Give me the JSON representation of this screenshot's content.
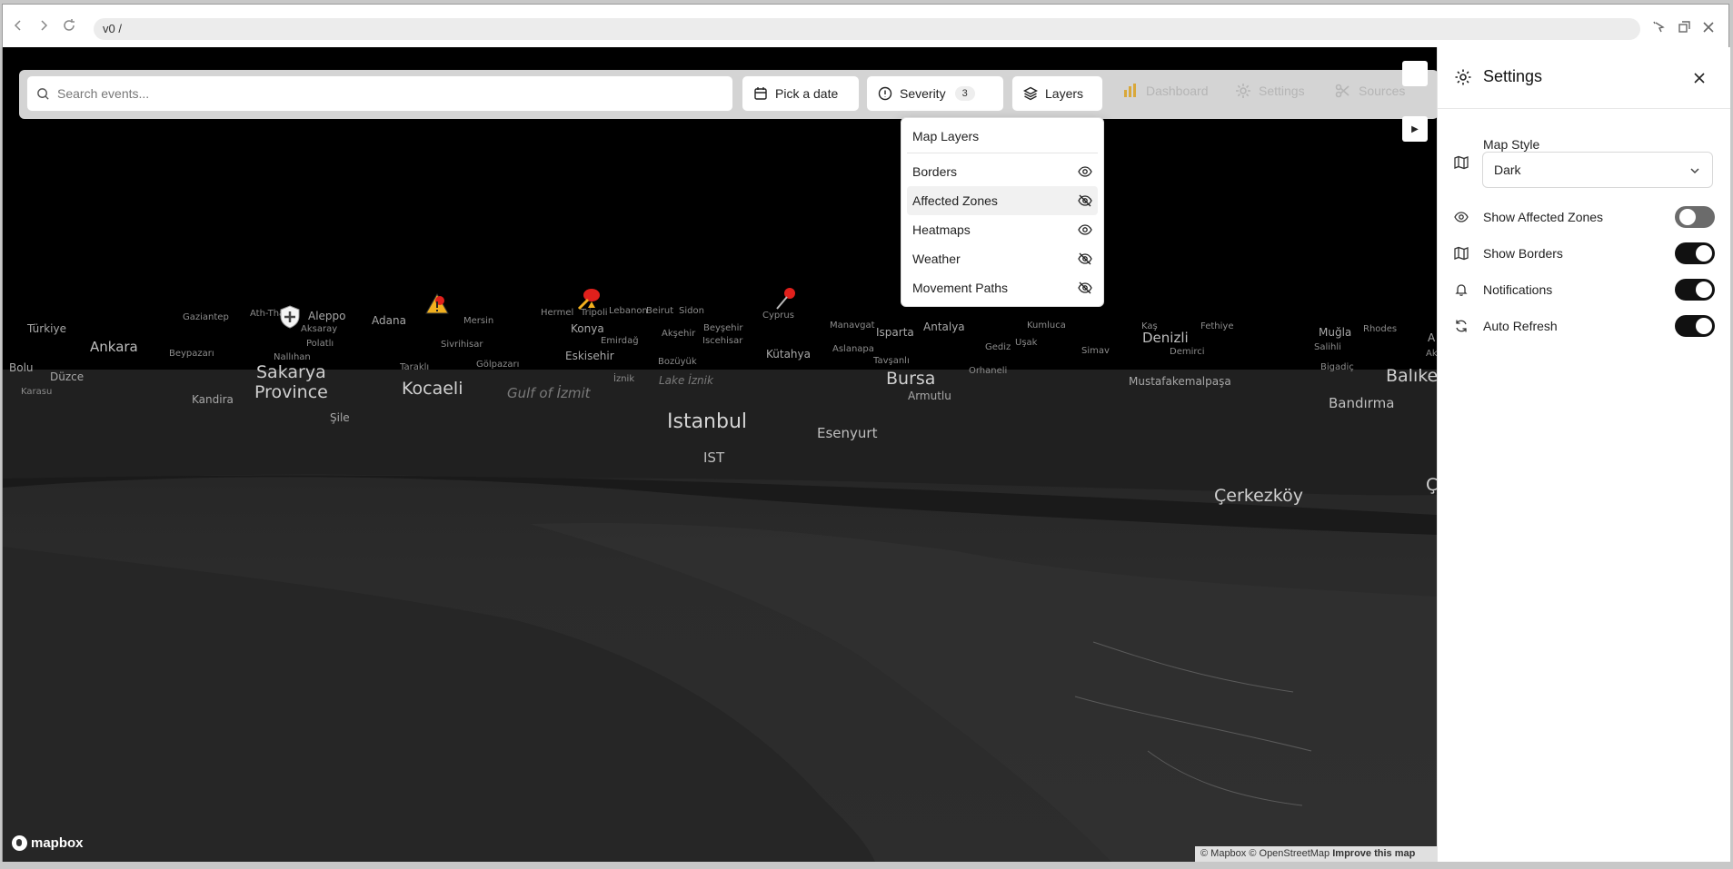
{
  "browser": {
    "url": "v0 /"
  },
  "toolbar": {
    "search_placeholder": "Search events...",
    "date_label": "Pick a date",
    "severity_label": "Severity",
    "severity_count": "3",
    "layers_label": "Layers",
    "dashboard_label": "Dashboard",
    "settings_label": "Settings",
    "sources_label": "Sources"
  },
  "layers_menu": {
    "title": "Map Layers",
    "items": [
      {
        "label": "Borders",
        "icon": "eye-icon"
      },
      {
        "label": "Affected Zones",
        "icon": "eye-off-icon"
      },
      {
        "label": "Heatmaps",
        "icon": "eye-icon"
      },
      {
        "label": "Weather",
        "icon": "eye-off-icon"
      },
      {
        "label": "Movement Paths",
        "icon": "eye-off-icon"
      }
    ]
  },
  "settings_panel": {
    "title": "Settings",
    "map_style_label": "Map Style",
    "map_style_value": "Dark",
    "toggles": [
      {
        "label": "Show Affected Zones",
        "on": false
      },
      {
        "label": "Show Borders",
        "on": true
      },
      {
        "label": "Notifications",
        "on": true
      },
      {
        "label": "Auto Refresh",
        "on": true
      }
    ]
  },
  "map": {
    "labels": [
      {
        "t": "Türkiye",
        "c": "s2"
      },
      {
        "t": "Gaziantep",
        "c": "s1"
      },
      {
        "t": "Aleppo",
        "c": "s2"
      },
      {
        "t": "Aksaray",
        "c": "s1"
      },
      {
        "t": "Adana",
        "c": "s2"
      },
      {
        "t": "Mersin",
        "c": "s1"
      },
      {
        "t": "Hermel",
        "c": "s1"
      },
      {
        "t": "Tripoli",
        "c": "s1"
      },
      {
        "t": "Lebanon",
        "c": "s1"
      },
      {
        "t": "Beirut",
        "c": "s1"
      },
      {
        "t": "Sidon",
        "c": "s1"
      },
      {
        "t": "Konya",
        "c": "s2"
      },
      {
        "t": "Cyprus",
        "c": "s1"
      },
      {
        "t": "Manavgat",
        "c": "s1"
      },
      {
        "t": "Isparta",
        "c": "s2"
      },
      {
        "t": "Antalya",
        "c": "s2"
      },
      {
        "t": "Kumluca",
        "c": "s1"
      },
      {
        "t": "Kaş",
        "c": "s1"
      },
      {
        "t": "Fethiye",
        "c": "s1"
      },
      {
        "t": "Denizli",
        "c": "s3"
      },
      {
        "t": "Muğla",
        "c": "s2"
      },
      {
        "t": "Rhodes",
        "c": "s1"
      },
      {
        "t": "Ankara",
        "c": "s3"
      },
      {
        "t": "Polatlı",
        "c": "s1"
      },
      {
        "t": "Beypazarı",
        "c": "s1"
      },
      {
        "t": "Nallıhan",
        "c": "s1"
      },
      {
        "t": "Sivrihisar",
        "c": "s1"
      },
      {
        "t": "Emirdağ",
        "c": "s1"
      },
      {
        "t": "Akşehir",
        "c": "s1"
      },
      {
        "t": "Beyşehir",
        "c": "s1"
      },
      {
        "t": "Iscehisar",
        "c": "s1"
      },
      {
        "t": "Eskisehir",
        "c": "s2"
      },
      {
        "t": "Bozüyük",
        "c": "s1"
      },
      {
        "t": "Kütahya",
        "c": "s2"
      },
      {
        "t": "Aslanapa",
        "c": "s1"
      },
      {
        "t": "Tavşanlı",
        "c": "s1"
      },
      {
        "t": "Gediz",
        "c": "s1"
      },
      {
        "t": "Uşak",
        "c": "s1"
      },
      {
        "t": "Simav",
        "c": "s1"
      },
      {
        "t": "Demirci",
        "c": "s1"
      },
      {
        "t": "Salihli",
        "c": "s1"
      },
      {
        "t": "Bolu",
        "c": "s2"
      },
      {
        "t": "Düzce",
        "c": "s2"
      },
      {
        "t": "Karasu",
        "c": "s1"
      },
      {
        "t": "Sakarya",
        "c": "s4"
      },
      {
        "t": "Province",
        "c": "s4"
      },
      {
        "t": "Taraklı",
        "c": "s1"
      },
      {
        "t": "Gölpazarı",
        "c": "s1"
      },
      {
        "t": "Kocaeli",
        "c": "s4"
      },
      {
        "t": "İznik",
        "c": "s1"
      },
      {
        "t": "Gulf of İzmit",
        "c": "s3 italic"
      },
      {
        "t": "Lake İznik",
        "c": "s2 italic"
      },
      {
        "t": "Bursa",
        "c": "s4"
      },
      {
        "t": "Orhaneli",
        "c": "s1"
      },
      {
        "t": "Mustafakemalpaşa",
        "c": "s2"
      },
      {
        "t": "Bigadiç",
        "c": "s1"
      },
      {
        "t": "Balıkes",
        "c": "s4"
      },
      {
        "t": "Kandira",
        "c": "s2"
      },
      {
        "t": "Armutlu",
        "c": "s2"
      },
      {
        "t": "Bandırma",
        "c": "s3"
      },
      {
        "t": "Şile",
        "c": "s2"
      },
      {
        "t": "Istanbul",
        "c": "s5"
      },
      {
        "t": "Esenyurt",
        "c": "s3"
      },
      {
        "t": "IST",
        "c": "s3"
      },
      {
        "t": "Çerkezköy",
        "c": "s4"
      },
      {
        "t": "Ak",
        "c": "s1"
      },
      {
        "t": "A",
        "c": "s2"
      },
      {
        "t": "Ç",
        "c": "s4"
      },
      {
        "t": "Ath-Thawr",
        "c": "s1"
      }
    ],
    "logo_text": "mapbox",
    "attribution_prefix": "© Mapbox © OpenStreetMap",
    "attribution_link": "Improve this map"
  },
  "colors": {
    "marker_red": "#e0201c",
    "marker_yellow": "#f2b01e",
    "toggle_on": "#111111"
  }
}
